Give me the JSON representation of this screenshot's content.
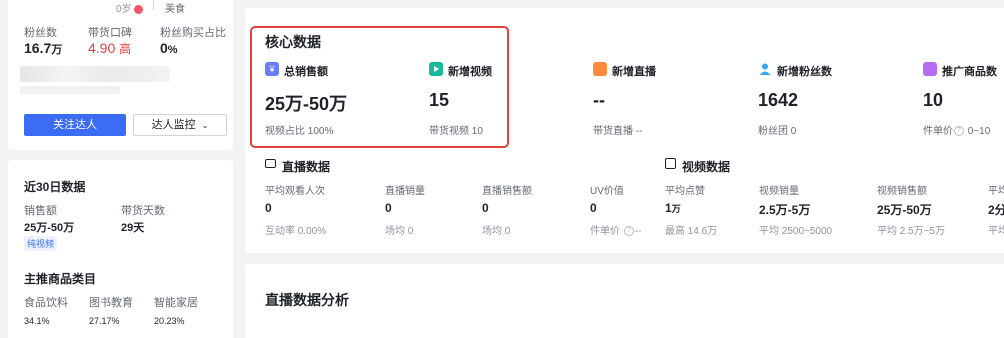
{
  "profile": {
    "top_left": "0岁",
    "top_right": "美食",
    "stats": [
      {
        "label": "粉丝数",
        "value": "16.7",
        "unit": "万"
      },
      {
        "label": "带货口碑",
        "value": "4.90",
        "unit": "高"
      },
      {
        "label": "粉丝购买占比",
        "value": "0",
        "unit": "%"
      }
    ],
    "follow_button": "关注达人",
    "monitor_button": "达人监控"
  },
  "recent": {
    "title": "近30日数据",
    "sales_label": "销售额",
    "sales_value": "25万-50万",
    "days_label": "带货天数",
    "days_value": "29天",
    "tag": "纯视频"
  },
  "categories": {
    "title": "主推商品类目",
    "items": [
      {
        "name": "食品饮料",
        "pct": "34.1%"
      },
      {
        "name": "图书教育",
        "pct": "27.17%"
      },
      {
        "name": "智能家居",
        "pct": "20.23%"
      }
    ]
  },
  "core": {
    "title": "核心数据",
    "metrics": [
      {
        "label": "总销售额",
        "value": "25万-50万",
        "sub": "视频占比 100%",
        "color": "#6b7cff"
      },
      {
        "label": "新增视频",
        "value": "15",
        "sub": "带货视频 10",
        "color": "#17b89b"
      },
      {
        "label": "新增直播",
        "value": "--",
        "sub": "带货直播 --",
        "color": "#ff8a3d"
      },
      {
        "label": "新增粉丝数",
        "value": "1642",
        "sub": "粉丝团 0",
        "color": "#3aa5f5"
      },
      {
        "label": "推广商品数",
        "value": "10",
        "sub_prefix": "件单价",
        "sub_value": "0~10",
        "color": "#b56cf0"
      }
    ]
  },
  "live": {
    "title": "直播数据",
    "metrics": [
      {
        "label": "平均观看人次",
        "value": "0",
        "sub": "互动率 0.00%"
      },
      {
        "label": "直播销量",
        "value": "0",
        "sub": "场均 0"
      },
      {
        "label": "直播销售额",
        "value": "0",
        "sub": "场均 0"
      },
      {
        "label": "UV价值",
        "value": "0",
        "sub_prefix": "件单价",
        "sub_value": "--"
      }
    ]
  },
  "video": {
    "title": "视频数据",
    "metrics": [
      {
        "label": "平均点赞",
        "value": "1",
        "unit": "万",
        "sub": "最高 14.6万"
      },
      {
        "label": "视频销量",
        "value": "2.5万-5万",
        "sub": "平均 2500~5000"
      },
      {
        "label": "视频销售额",
        "value": "25万-50万",
        "sub": "平均 2.5万~5万"
      },
      {
        "label": "平均",
        "value": "2分",
        "sub": "平均"
      }
    ]
  },
  "analysis": {
    "title": "直播数据分析"
  },
  "colors": {
    "highlight_border": "#e0423b",
    "accent_blue": "#3b6cf6",
    "price_red": "#e0423b"
  }
}
